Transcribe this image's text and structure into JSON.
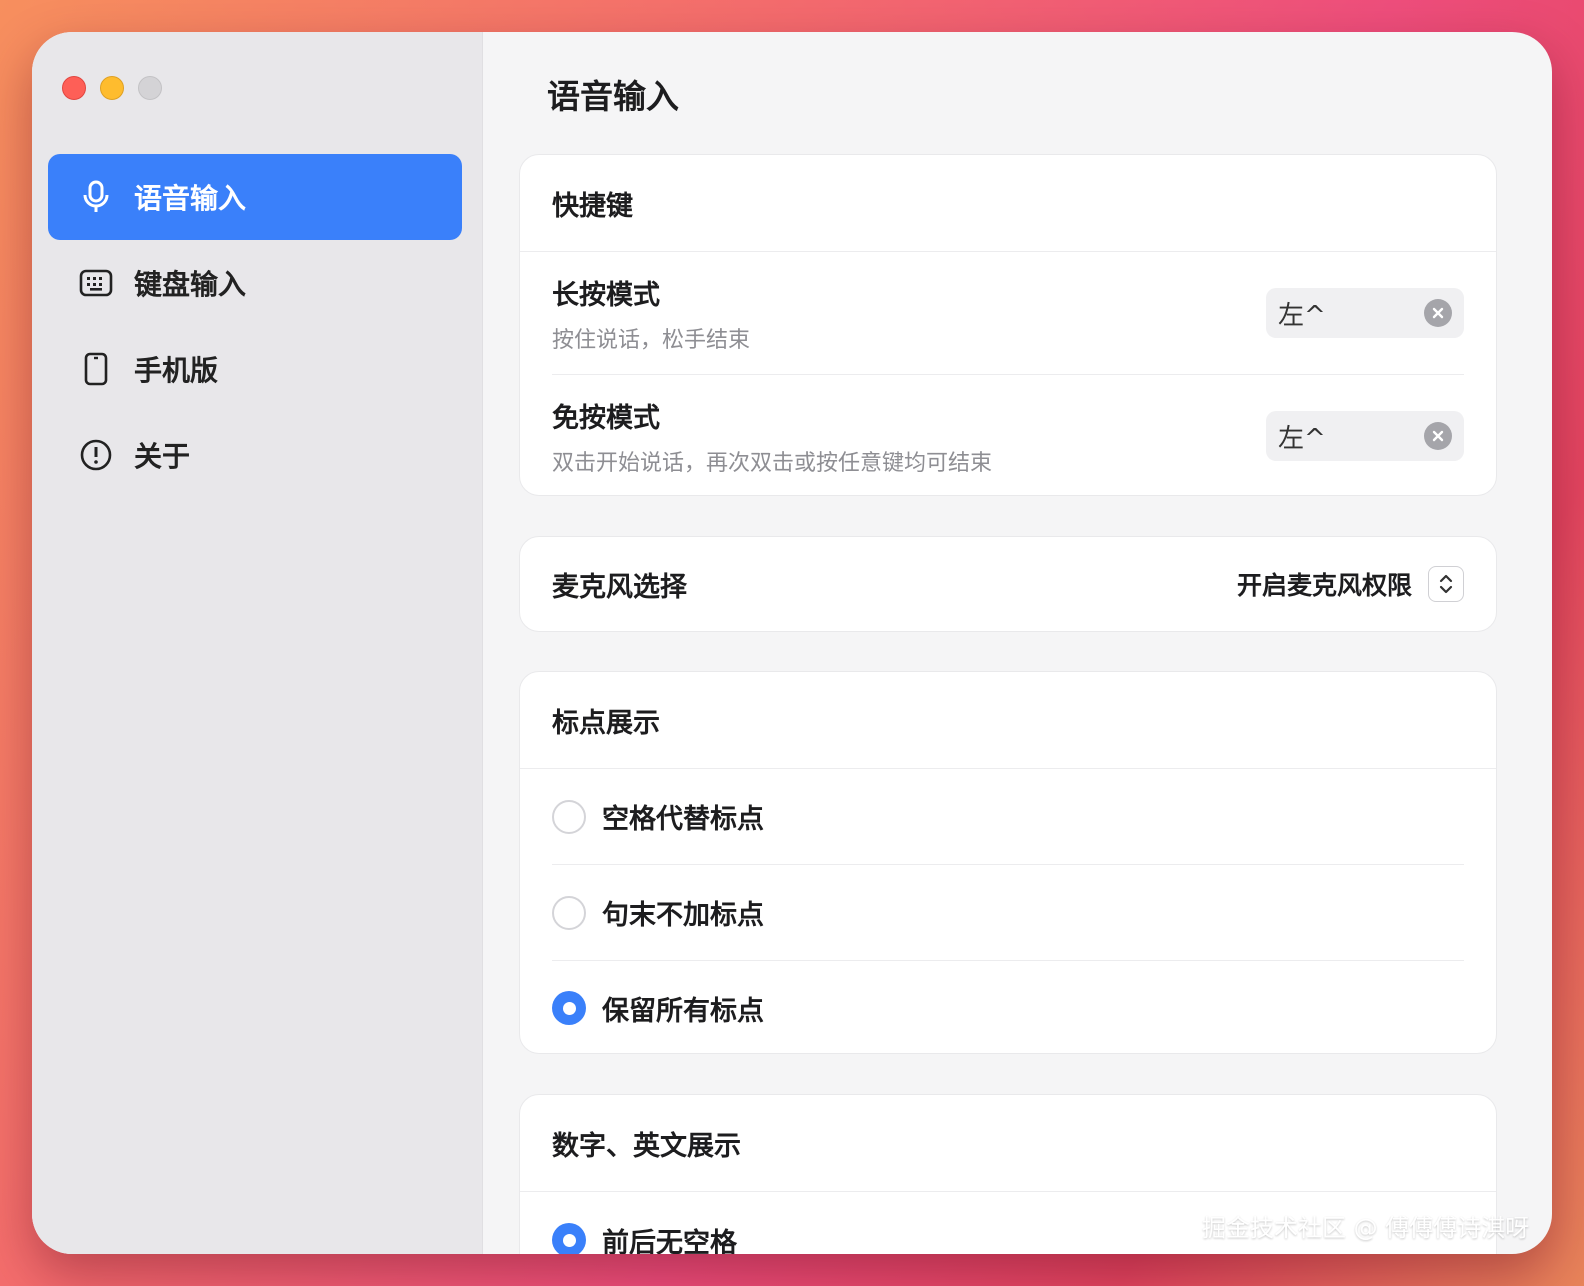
{
  "sidebar": {
    "items": [
      {
        "label": "语音输入",
        "icon": "microphone-icon",
        "active": true
      },
      {
        "label": "键盘输入",
        "icon": "keyboard-icon",
        "active": false
      },
      {
        "label": "手机版",
        "icon": "phone-icon",
        "active": false
      },
      {
        "label": "关于",
        "icon": "info-icon",
        "active": false
      }
    ]
  },
  "main": {
    "title": "语音输入",
    "shortcuts": {
      "header": "快捷键",
      "long_press": {
        "title": "长按模式",
        "subtitle": "按住说话，松手结束",
        "key": "左^"
      },
      "hands_free": {
        "title": "免按模式",
        "subtitle": "双击开始说话，再次双击或按任意键均可结束",
        "key": "左^"
      }
    },
    "microphone": {
      "label": "麦克风选择",
      "value": "开启麦克风权限"
    },
    "punctuation": {
      "header": "标点展示",
      "options": [
        {
          "label": "空格代替标点",
          "selected": false
        },
        {
          "label": "句末不加标点",
          "selected": false
        },
        {
          "label": "保留所有标点",
          "selected": true
        }
      ]
    },
    "numbers": {
      "header": "数字、英文展示",
      "first_option": {
        "label": "前后无空格",
        "selected": true
      }
    }
  },
  "watermark": "掘金技术社区 @ 傅傅傅诗淇呀",
  "colors": {
    "accent": "#3a80fa",
    "sidebar_bg": "#e8e7ea",
    "main_bg": "#f5f5f6"
  }
}
